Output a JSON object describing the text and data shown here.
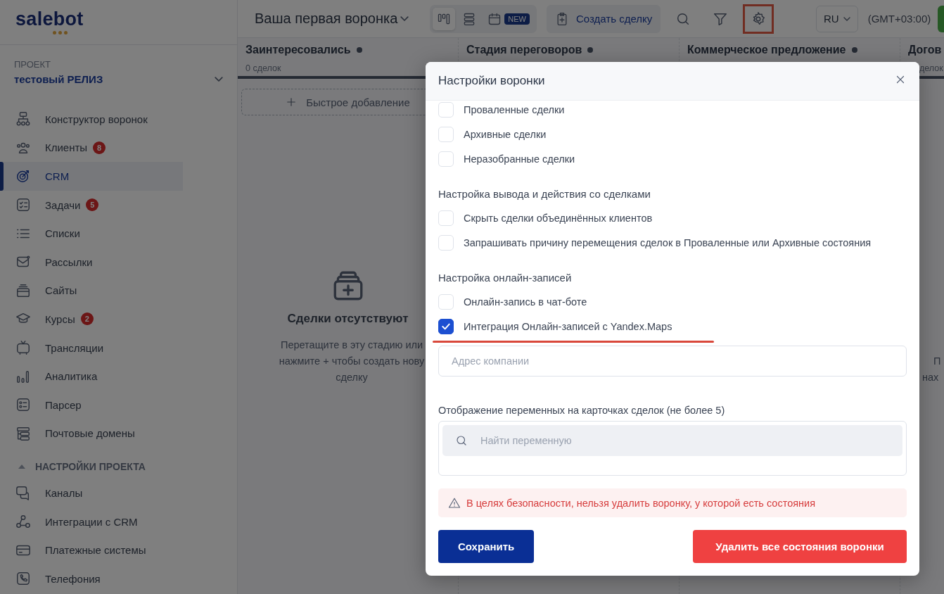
{
  "sidebar": {
    "logo": "salebot",
    "project_label": "ПРОЕКТ",
    "project_name": "тестовый РЕЛИЗ",
    "items": [
      {
        "label": "Конструктор воронок",
        "selected": false
      },
      {
        "label": "Клиенты",
        "badge": "8",
        "selected": false
      },
      {
        "label": "CRM",
        "selected": true
      },
      {
        "label": "Задачи",
        "badge": "5",
        "selected": false
      },
      {
        "label": "Списки",
        "selected": false
      },
      {
        "label": "Рассылки",
        "selected": false
      },
      {
        "label": "Сайты",
        "selected": false
      },
      {
        "label": "Курсы",
        "badge": "2",
        "selected": false
      },
      {
        "label": "Трансляции",
        "selected": false
      },
      {
        "label": "Аналитика",
        "selected": false
      },
      {
        "label": "Парсер",
        "selected": false
      },
      {
        "label": "Почтовые домены",
        "selected": false
      }
    ],
    "section": {
      "title": "НАСТРОЙКИ ПРОЕКТА",
      "expanded": true,
      "items": [
        {
          "label": "Каналы",
          "selected": false
        },
        {
          "label": "Интеграции с CRM",
          "selected": false
        },
        {
          "label": "Платежные системы",
          "selected": false
        },
        {
          "label": "Телефония",
          "selected": false
        }
      ]
    }
  },
  "header": {
    "funnel_title": "Ваша первая воронка",
    "views": [
      {
        "selected": true
      },
      {
        "selected": false
      },
      {
        "selected": false,
        "badge": "NEW"
      }
    ],
    "create_button": "Создать сделку",
    "tools": [
      {
        "highlighted": false
      },
      {
        "highlighted": false
      },
      {
        "highlighted": true
      }
    ],
    "language": "RU",
    "timezone": "(GMT+03:00)"
  },
  "board": {
    "columns": [
      {
        "title": "Заинтересовались",
        "count": "0 сделок",
        "quick_add": "Быстрое добавление",
        "empty_title": "Сделки отсутствуют",
        "empty_text": [
          "Перетащите в эту стадию или",
          "нажмите + чтобы создать нову",
          "сделку"
        ]
      },
      {
        "title": "Стадия переговоров"
      },
      {
        "title": "Коммерческое предложение"
      },
      {
        "title": "Догов",
        "count": "делок",
        "empty_text": [
          "П",
          "нах"
        ]
      }
    ]
  },
  "dialog": {
    "title": "Настройки воронки",
    "groups": [
      {
        "options": [
          {
            "label": "Проваленные сделки",
            "checked": false
          },
          {
            "label": "Архивные сделки",
            "checked": false
          },
          {
            "label": "Неразобранные сделки",
            "checked": false
          }
        ]
      },
      {
        "title": "Настройка вывода и действия со сделками",
        "options": [
          {
            "label": "Скрыть сделки объединённых клиентов",
            "checked": false
          },
          {
            "label": "Запрашивать причину перемещения сделок в Проваленные или Архивные состояния",
            "checked": false
          }
        ]
      },
      {
        "title": "Настройка онлайн-записей",
        "options": [
          {
            "label": "Онлайн-запись в чат-боте",
            "checked": false
          },
          {
            "label": "Интеграция Онлайн-записей с Yandex.Maps",
            "checked": true,
            "underlined": true
          }
        ]
      }
    ],
    "address": {
      "placeholder": "Адрес компании"
    },
    "variables_label": "Отображение переменных на карточках сделок (не более 5)",
    "variables_search": {
      "placeholder": "Найти переменную"
    },
    "warning": "В целях безопасности, нельзя удалить воронку, у которой есть состояния",
    "save_button": "Сохранить",
    "delete_button": "Удалить все состояния воронки"
  }
}
